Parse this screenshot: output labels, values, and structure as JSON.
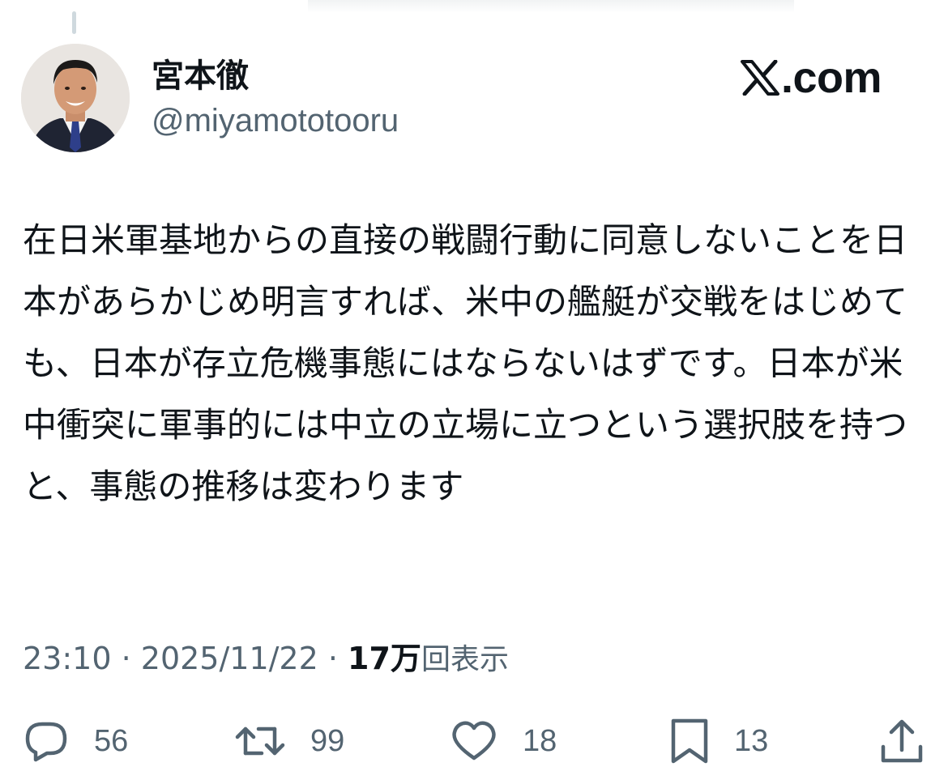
{
  "author": {
    "display_name": "宮本徹",
    "handle": "@miyamototooru"
  },
  "brand": {
    "logo_icon": "x-logo-icon",
    "text": ".com"
  },
  "tweet": {
    "text": "在日米軍基地からの直接の戦闘行動に同意しないことを日本があらかじめ明言すれば、米中の艦艇が交戦をはじめても、日本が存立危機事態にはならないはずです。日本が米中衝突に軍事的には中立の立場に立つという選択肢を持つと、事態の推移は変わります"
  },
  "meta": {
    "time": "23:10",
    "separator1": " · ",
    "date": "2025/11/22",
    "separator2": " · ",
    "views_number": "17万",
    "views_label": "回表示"
  },
  "actions": {
    "reply": {
      "icon": "reply-icon",
      "count": "56"
    },
    "repost": {
      "icon": "repost-icon",
      "count": "99"
    },
    "like": {
      "icon": "heart-icon",
      "count": "18"
    },
    "bookmark": {
      "icon": "bookmark-icon",
      "count": "13"
    },
    "share": {
      "icon": "share-icon"
    }
  },
  "colors": {
    "text_primary": "#0f1419",
    "text_secondary": "#536471",
    "background": "#ffffff"
  }
}
